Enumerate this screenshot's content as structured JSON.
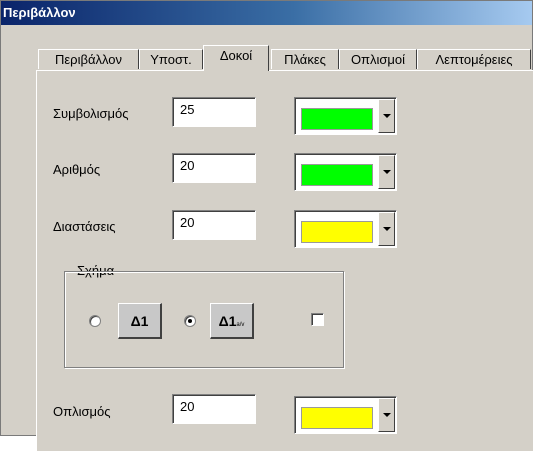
{
  "window": {
    "title": "Περιβάλλον"
  },
  "tabs": [
    {
      "label": "Περιβάλλον"
    },
    {
      "label": "Υποστ."
    },
    {
      "label": "Δοκοί",
      "active": true
    },
    {
      "label": "Πλάκες"
    },
    {
      "label": "Οπλισμοί"
    },
    {
      "label": "Λεπτομέρειες"
    }
  ],
  "fields": {
    "symbolism": {
      "label": "Συμβολισμός",
      "value": "25",
      "color": "#00ff00"
    },
    "number": {
      "label": "Αριθμός",
      "value": "20",
      "color": "#00ff00"
    },
    "dimensions": {
      "label": "Διαστάσεις",
      "value": "20",
      "color": "#ffff00"
    },
    "reinforcement": {
      "label": "Οπλισμός",
      "value": "20",
      "color": "#ffff00"
    }
  },
  "shape_group": {
    "title": "Σχήμα",
    "option1": {
      "symbol": "Δ1",
      "selected": false
    },
    "option2": {
      "symbol": "Δ1",
      "sub": "a/v",
      "selected": true
    },
    "checkbox_checked": false
  }
}
